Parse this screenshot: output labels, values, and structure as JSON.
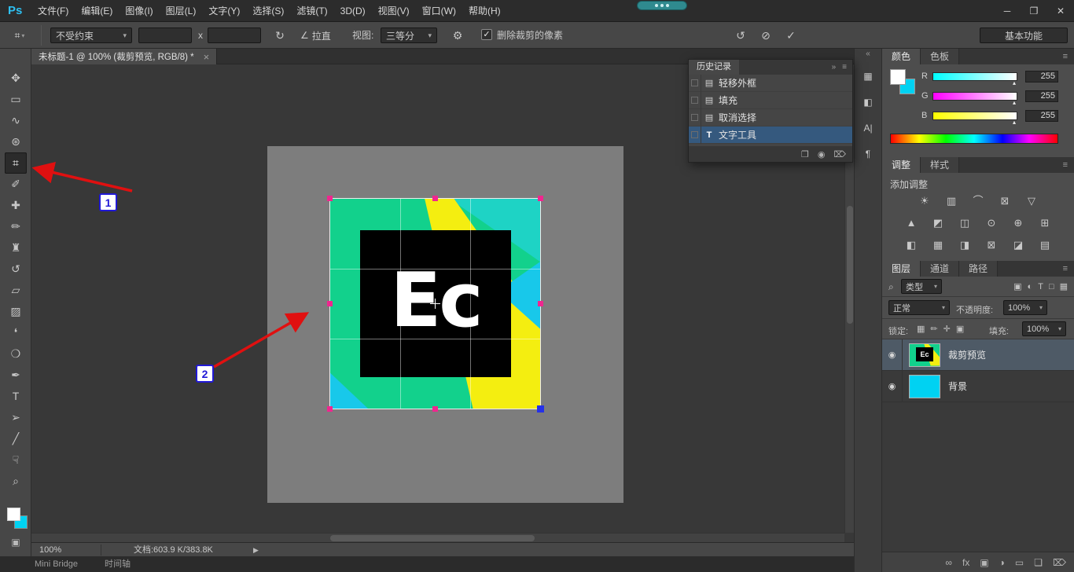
{
  "ui": {
    "caret": "▾",
    "slider_handle": "▴"
  },
  "colors": {
    "arrow_red": "#e01010",
    "label_blue": "#2119d6",
    "selection_blue": "#35597e",
    "foreground_color": "#ffffff",
    "background_color_cyan": "#00d2f2",
    "logo_green": "#12d18c",
    "logo_yellow": "#f4ee10",
    "logo_cyan": "#18c8ea"
  },
  "titlebar": {
    "logo": "Ps",
    "menus": [
      "文件(F)",
      "编辑(E)",
      "图像(I)",
      "图层(L)",
      "文字(Y)",
      "选择(S)",
      "滤镜(T)",
      "3D(D)",
      "视图(V)",
      "窗口(W)",
      "帮助(H)"
    ],
    "window_controls": {
      "minimize": "─",
      "restore": "❐",
      "close": "✕"
    }
  },
  "options_bar": {
    "tool_icon": "⌗",
    "preset_select": "不受约束",
    "width_value": "",
    "height_value": "",
    "dim_separator": "x",
    "swap_icon": "↻",
    "straighten_icon": "∠",
    "straighten_label": "拉直",
    "view_label": "视图:",
    "view_select": "三等分",
    "gear_icon": "⚙",
    "checkbox_check": "✓",
    "delete_pixels_label": "删除裁剪的像素",
    "reset_icon": "↺",
    "cancel_icon": "⊘",
    "commit_icon": "✓",
    "workspace_button": "基本功能"
  },
  "document_tab": {
    "title": "未标题-1 @ 100% (裁剪预览, RGB/8) *",
    "close_icon": "×"
  },
  "toolbar": {
    "quick_mask_icon": "▣",
    "tools": [
      {
        "name": "move-tool",
        "glyph": "✥"
      },
      {
        "name": "rectangular-marquee-tool",
        "glyph": "▭"
      },
      {
        "name": "lasso-tool",
        "glyph": "∿"
      },
      {
        "name": "quick-selection-tool",
        "glyph": "⊛"
      },
      {
        "name": "crop-tool",
        "glyph": "⌗"
      },
      {
        "name": "eyedropper-tool",
        "glyph": "✐"
      },
      {
        "name": "healing-brush-tool",
        "glyph": "✚"
      },
      {
        "name": "brush-tool",
        "glyph": "✏"
      },
      {
        "name": "clone-stamp-tool",
        "glyph": "♜"
      },
      {
        "name": "history-brush-tool",
        "glyph": "↺"
      },
      {
        "name": "eraser-tool",
        "glyph": "▱"
      },
      {
        "name": "gradient-tool",
        "glyph": "▨"
      },
      {
        "name": "blur-tool",
        "glyph": "❛"
      },
      {
        "name": "dodge-tool",
        "glyph": "❍"
      },
      {
        "name": "pen-tool",
        "glyph": "✒"
      },
      {
        "name": "type-tool",
        "glyph": "T"
      },
      {
        "name": "path-selection-tool",
        "glyph": "➢"
      },
      {
        "name": "line-tool",
        "glyph": "╱"
      },
      {
        "name": "hand-tool",
        "glyph": "☟"
      },
      {
        "name": "zoom-tool",
        "glyph": "⌕"
      }
    ]
  },
  "canvas": {
    "logo_text": "Ec"
  },
  "annotations": {
    "step1": "1",
    "step2": "2"
  },
  "history_panel": {
    "title": "历史记录",
    "expand_icon": "»",
    "menu_icon": "≡",
    "items": [
      {
        "icon": "▤",
        "label": "轻移外框"
      },
      {
        "icon": "▤",
        "label": "填充"
      },
      {
        "icon": "▤",
        "label": "取消选择"
      },
      {
        "icon": "T",
        "label": "文字工具"
      }
    ],
    "footer_icons": {
      "new_doc": "❐",
      "snapshot": "◉",
      "delete": "⌦"
    }
  },
  "dock": {
    "collapse_icon": "«",
    "icons": [
      {
        "name": "info-panel",
        "glyph": "▦"
      },
      {
        "name": "properties-panel",
        "glyph": "◧"
      },
      {
        "name": "character-panel",
        "glyph": "A|"
      },
      {
        "name": "paragraph-panel",
        "glyph": "¶"
      }
    ]
  },
  "color_panel": {
    "tabs": [
      "颜色",
      "色板"
    ],
    "menu_icon": "≡",
    "channels": [
      {
        "label": "R",
        "value": "255"
      },
      {
        "label": "G",
        "value": "255"
      },
      {
        "label": "B",
        "value": "255"
      }
    ]
  },
  "adjustments_panel": {
    "tabs": [
      "调整",
      "样式"
    ],
    "menu_icon": "≡",
    "hint": "添加调整",
    "rows": [
      [
        "☀",
        "▥",
        "⌒",
        "⊠",
        "▽"
      ],
      [
        "▲",
        "◩",
        "◫",
        "⊙",
        "⊕",
        "⊞"
      ],
      [
        "◧",
        "▦",
        "◨",
        "⊠",
        "◪",
        "▤"
      ]
    ]
  },
  "layers_panel": {
    "tabs": [
      "图层",
      "通道",
      "路径"
    ],
    "menu_icon": "≡",
    "search_icon": "⌕",
    "kind_label": "类型",
    "filter_icons": [
      "▣",
      "◐",
      "T",
      "□",
      "▦"
    ],
    "blend_mode": "正常",
    "opacity_label": "不透明度:",
    "opacity_value": "100%",
    "lock_label": "锁定:",
    "lock_icons": [
      "▦",
      "✏",
      "✛",
      "▣"
    ],
    "fill_label": "填充:",
    "fill_value": "100%",
    "eye_icon": "◉",
    "layers": [
      {
        "name": "裁剪预览"
      },
      {
        "name": "背景"
      }
    ],
    "footer_icons": {
      "link": "∞",
      "fx": "fx",
      "mask": "▣",
      "adjust": "◑",
      "group": "▭",
      "new": "❏",
      "delete": "⌦"
    }
  },
  "status_bar": {
    "zoom": "100%",
    "doc_info": "文档:603.9 K/383.8K",
    "arrow": "▶"
  },
  "bottom_bar": {
    "tabs": [
      "Mini Bridge",
      "时间轴"
    ]
  }
}
